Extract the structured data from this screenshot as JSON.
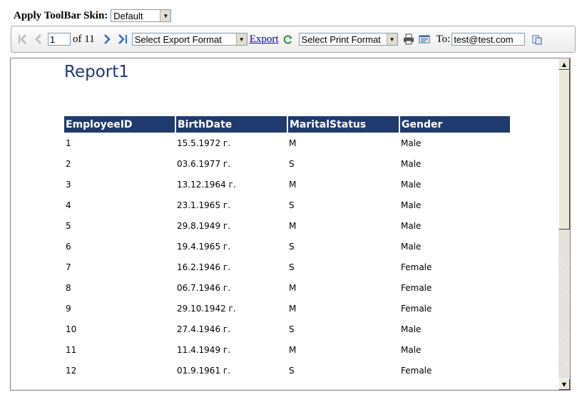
{
  "skin": {
    "label": "Apply ToolBar Skin:",
    "selected": "Default"
  },
  "toolbar": {
    "page_current": "1",
    "page_total_label": "of 11",
    "export_format_selected": "Select Export Format",
    "export_label": "Export",
    "print_format_selected": "Select Print Format",
    "to_label": "To:",
    "email_value": "test@test.com"
  },
  "report": {
    "title": "Report1",
    "columns": [
      "EmployeeID",
      "BirthDate",
      "MaritalStatus",
      "Gender"
    ],
    "rows": [
      [
        "1",
        "15.5.1972 г.",
        "M",
        "Male"
      ],
      [
        "2",
        "03.6.1977 г.",
        "S",
        "Male"
      ],
      [
        "3",
        "13.12.1964 г.",
        "M",
        "Male"
      ],
      [
        "4",
        "23.1.1965 г.",
        "S",
        "Male"
      ],
      [
        "5",
        "29.8.1949 г.",
        "M",
        "Male"
      ],
      [
        "6",
        "19.4.1965 г.",
        "S",
        "Male"
      ],
      [
        "7",
        "16.2.1946 г.",
        "S",
        "Female"
      ],
      [
        "8",
        "06.7.1946 г.",
        "M",
        "Female"
      ],
      [
        "9",
        "29.10.1942 г.",
        "M",
        "Female"
      ],
      [
        "10",
        "27.4.1946 г.",
        "S",
        "Male"
      ],
      [
        "11",
        "11.4.1949 г.",
        "M",
        "Male"
      ],
      [
        "12",
        "01.9.1961 г.",
        "S",
        "Female"
      ]
    ]
  },
  "colors": {
    "header_bg": "#1f3a6e",
    "title": "#1f3a6e",
    "link": "#0000cc",
    "nav_active": "#2b6cc4",
    "nav_disabled": "#b8b8b8"
  }
}
